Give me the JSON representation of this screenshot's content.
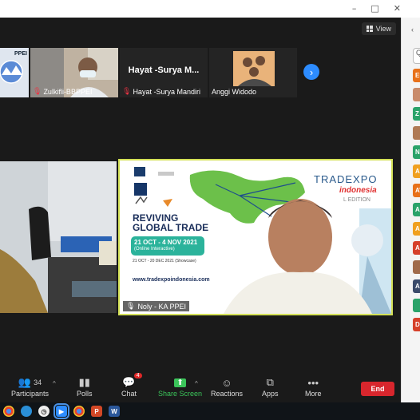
{
  "window": {
    "controls": [
      "–",
      "□",
      "✕"
    ]
  },
  "view_button": {
    "label": "View"
  },
  "thumbnails": [
    {
      "name": "",
      "logo_text": "PPEI",
      "muted": false
    },
    {
      "name": "Zulkifli-BBPPEI",
      "muted": true
    },
    {
      "title": "Hayat -Surya M...",
      "name": "Hayat -Surya Mandiri",
      "muted": true
    },
    {
      "name": "Anggi Widodo",
      "muted": false
    }
  ],
  "main_tiles": {
    "right_name": "Noly - KA PPEI",
    "slide": {
      "brand_top": "TRADEXPO",
      "brand_bottom": "indonesia",
      "edition": "L EDITION",
      "headline_1": "REVIVING",
      "headline_2": "GLOBAL TRADE",
      "date_main": "21 OCT - 4 NOV 2021",
      "date_main_sub": "(Online Interactive)",
      "date_second": "21 OCT - 20 DEC 2021 (Showcase)",
      "url": "www.tradexpoindonesia.com"
    }
  },
  "toolbar": {
    "participants_label": "Participants",
    "participants_count": "34",
    "polls_label": "Polls",
    "chat_label": "Chat",
    "chat_badge": "4",
    "share_label": "Share Screen",
    "reactions_label": "Reactions",
    "apps_label": "Apps",
    "more_label": "More",
    "end_label": "End"
  },
  "panel": {
    "close": "‹",
    "search": "Q",
    "avatars": [
      {
        "text": "El",
        "color": "#e8711a"
      },
      {
        "text": "",
        "color": "#c98b6b"
      },
      {
        "text": "Z",
        "color": "#2aa36a"
      },
      {
        "text": "",
        "color": "#b07a55"
      },
      {
        "text": "N",
        "color": "#2aa36a"
      },
      {
        "text": "AA",
        "color": "#f0a020"
      },
      {
        "text": "AV",
        "color": "#e8711a"
      },
      {
        "text": "AS",
        "color": "#2aa36a"
      },
      {
        "text": "AI",
        "color": "#f0a020"
      },
      {
        "text": "AK",
        "color": "#d6402a"
      },
      {
        "text": "",
        "color": "#a06a4a"
      },
      {
        "text": "AA",
        "color": "#3a4a6a"
      },
      {
        "text": "",
        "color": "#2aa36a"
      },
      {
        "text": "DI",
        "color": "#d6402a"
      }
    ]
  },
  "taskbar": {
    "icons": [
      "chrome",
      "edge",
      "clock",
      "zoom",
      "chrome2",
      "ppt",
      "word"
    ]
  }
}
